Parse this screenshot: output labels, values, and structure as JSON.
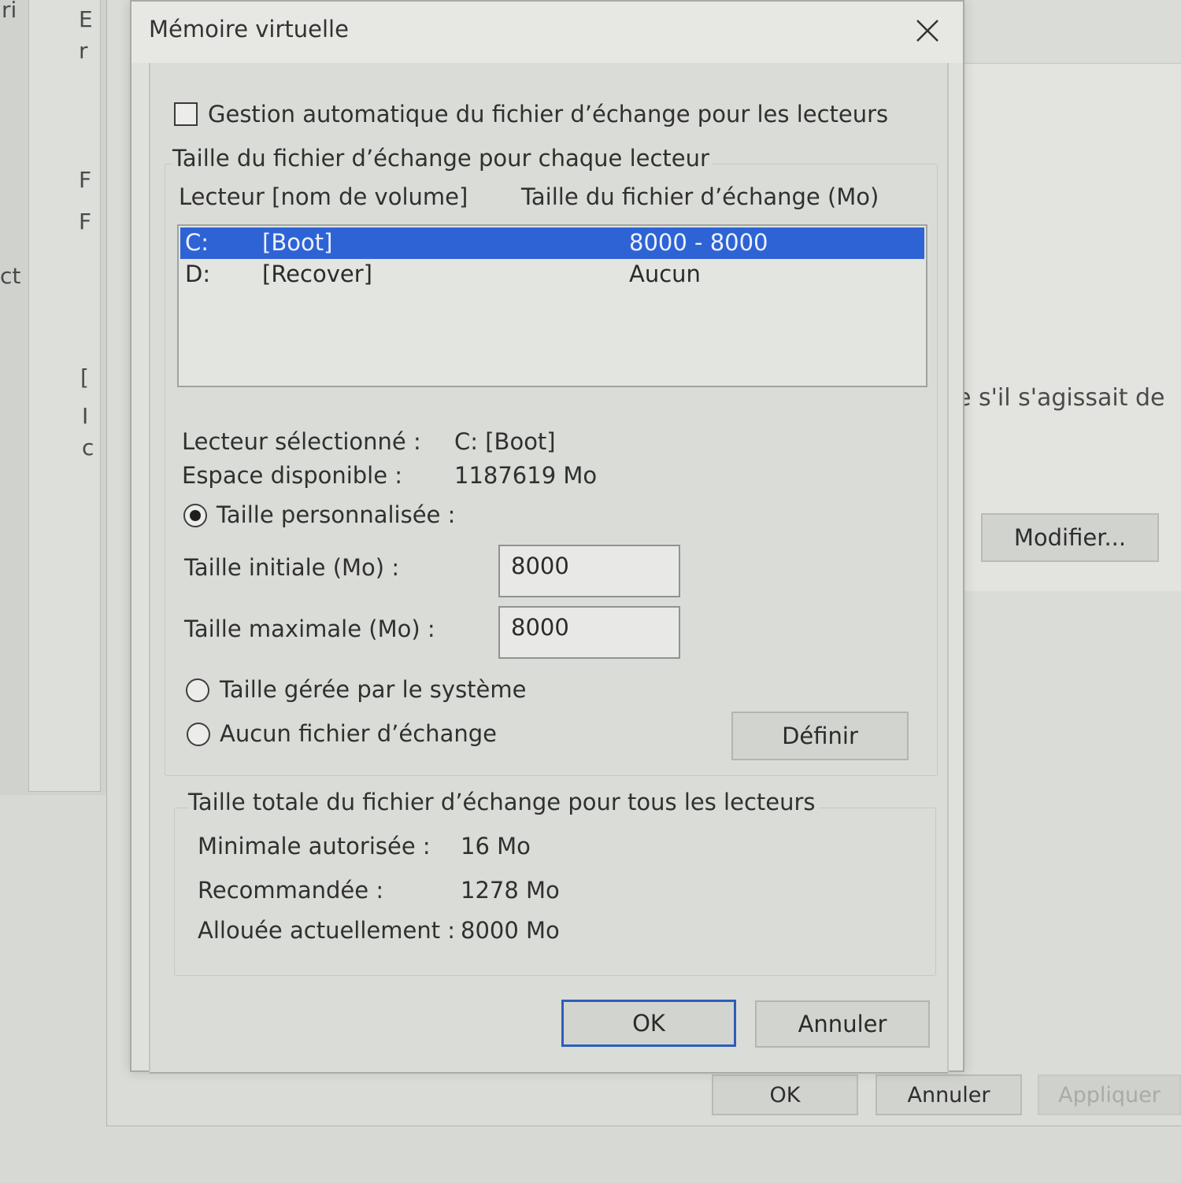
{
  "background": {
    "left_fragments": [
      "ri",
      "E",
      "r",
      "F",
      "F",
      "ct",
      "[",
      "I",
      "c"
    ],
    "right_text": "e s'il s'agissait de",
    "modify_button": "Modifier...",
    "ok_button": "OK",
    "cancel_button": "Annuler",
    "apply_button": "Appliquer"
  },
  "dialog": {
    "title": "Mémoire virtuelle",
    "close_icon": "close-icon",
    "auto_manage_label": "Gestion automatique du fichier d’échange pour les lecteurs",
    "auto_manage_checked": false,
    "per_drive_group_label": "Taille du fichier d’échange pour chaque lecteur",
    "columns": {
      "drive": "Lecteur [nom de volume]",
      "size": "Taille du fichier d’échange (Mo)"
    },
    "drives": [
      {
        "letter": "C:",
        "volume": "[Boot]",
        "size": "8000 - 8000",
        "selected": true
      },
      {
        "letter": "D:",
        "volume": "[Recover]",
        "size": "Aucun",
        "selected": false
      }
    ],
    "selected_drive_label": "Lecteur sélectionné :",
    "selected_drive_value": "C:  [Boot]",
    "available_space_label": "Espace disponible :",
    "available_space_value": "1187619 Mo",
    "custom_size_label": "Taille personnalisée :",
    "initial_size_label": "Taille initiale (Mo) :",
    "initial_size_value": "8000",
    "max_size_label": "Taille maximale (Mo) :",
    "max_size_value": "8000",
    "system_managed_label": "Taille gérée par le système",
    "no_paging_label": "Aucun fichier d’échange",
    "selected_option": "custom",
    "set_button": "Définir",
    "total_group_label": "Taille totale du fichier d’échange pour tous les lecteurs",
    "min_allowed_label": "Minimale autorisée :",
    "min_allowed_value": "16 Mo",
    "recommended_label": "Recommandée :",
    "recommended_value": "1278 Mo",
    "allocated_label": "Allouée actuellement :",
    "allocated_value": "8000 Mo",
    "ok_button": "OK",
    "cancel_button": "Annuler",
    "accent_color": "#2e63d6"
  }
}
